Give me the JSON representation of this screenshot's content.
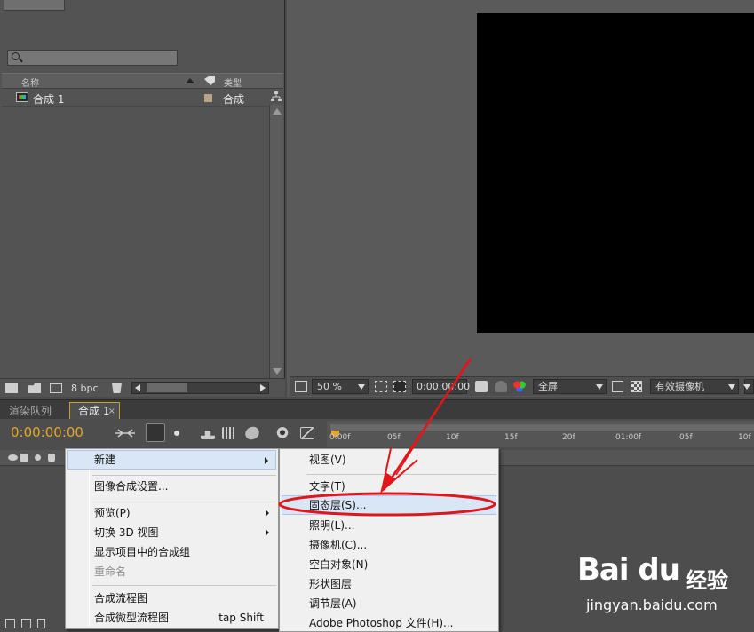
{
  "project_panel": {
    "search": {
      "placeholder": ""
    },
    "columns": {
      "name": "名称",
      "type": "类型"
    },
    "items": [
      {
        "name": "合成 1",
        "type": "合成",
        "label_color": "#b9a586"
      }
    ],
    "bottom": {
      "bpc": "8 bpc"
    }
  },
  "viewer": {
    "zoom": "50 %",
    "timecode": "0:00:00:00",
    "resolution": "全屏",
    "camera": "有效摄像机",
    "canvas_color": "#000000"
  },
  "timeline": {
    "tabs": [
      {
        "label": "渲染队列",
        "active": false
      },
      {
        "label": "合成 1",
        "active": true,
        "close": "×"
      }
    ],
    "timecode": "0:00:00:00",
    "timecode_color": "#e5a726",
    "ruler_ticks": [
      "0:00f",
      "05f",
      "10f",
      "15f",
      "20f",
      "01:00f",
      "05f",
      "10f"
    ]
  },
  "context_menu": {
    "items": [
      {
        "label": "新建",
        "submenu": true,
        "highlighted": true
      },
      {
        "label": "图像合成设置..."
      },
      {
        "label": "预览(P)",
        "submenu": true
      },
      {
        "label": "切换 3D 视图",
        "submenu": true
      },
      {
        "label": "显示项目中的合成组"
      },
      {
        "label": "重命名",
        "disabled": true
      },
      {
        "label": "合成流程图"
      },
      {
        "label": "合成微型流程图",
        "shortcut": "tap Shift"
      }
    ]
  },
  "submenu": {
    "items": [
      {
        "label": "视图(V)"
      },
      {
        "label": "文字(T)"
      },
      {
        "label": "固态层(S)...",
        "highlighted": true
      },
      {
        "label": "照明(L)..."
      },
      {
        "label": "摄像机(C)..."
      },
      {
        "label": "空白对象(N)"
      },
      {
        "label": "形状图层"
      },
      {
        "label": "调节层(A)"
      },
      {
        "label": "Adobe Photoshop 文件(H)..."
      }
    ]
  },
  "annotation": {
    "color": "#e0161b"
  },
  "watermark": {
    "logo": "Bai du",
    "brand": "经验",
    "url": "jingyan.baidu.com"
  }
}
